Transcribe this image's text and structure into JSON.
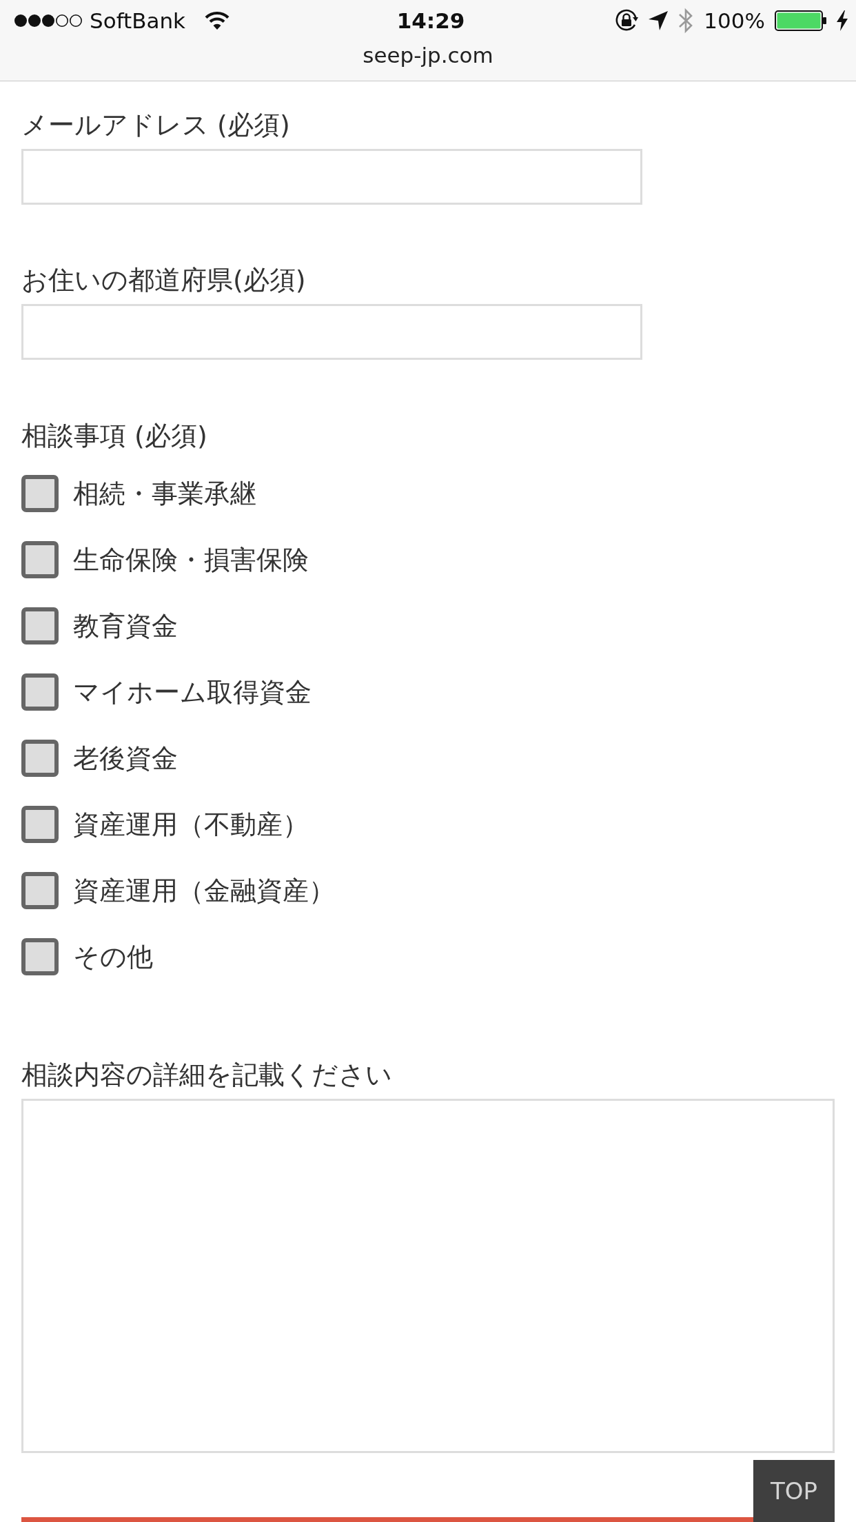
{
  "status_bar": {
    "carrier": "SoftBank",
    "time": "14:29",
    "battery": "100%"
  },
  "address_bar": {
    "url": "seep-jp.com"
  },
  "fields": [
    {
      "label": "メールアドレス (必須)"
    },
    {
      "label": "お住いの都道府県(必須)"
    }
  ],
  "consultation_topics": {
    "label": "相談事項 (必須)",
    "options": [
      {
        "label": "相続・事業承継",
        "checked": false
      },
      {
        "label": "生命保険・損害保険",
        "checked": false
      },
      {
        "label": "教育資金",
        "checked": false
      },
      {
        "label": "マイホーム取得資金",
        "checked": false
      },
      {
        "label": "老後資金",
        "checked": false
      },
      {
        "label": "資産運用（不動産）",
        "checked": false
      },
      {
        "label": "資産運用（金融資産）",
        "checked": false
      },
      {
        "label": "その他",
        "checked": false
      }
    ]
  },
  "details": {
    "label": "相談内容の詳細を記載ください"
  },
  "top_button": {
    "label": "TOP"
  }
}
